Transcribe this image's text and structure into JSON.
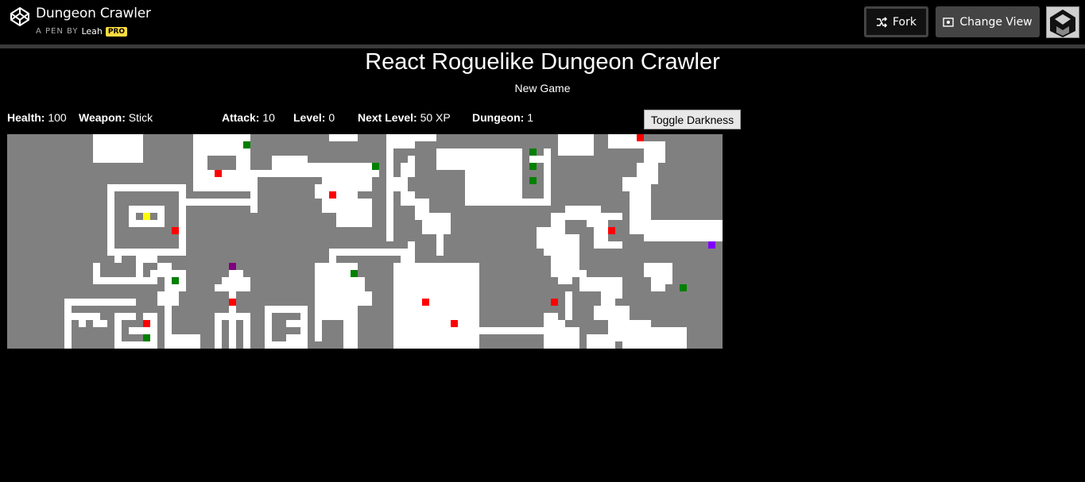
{
  "header": {
    "title": "Dungeon Crawler",
    "byline": "A PEN BY",
    "author": "Leah",
    "pro_badge": "PRO",
    "fork_label": "Fork",
    "change_view_label": "Change View"
  },
  "game": {
    "title": "React Roguelike Dungeon Crawler",
    "new_game": "New Game",
    "toggle_darkness": "Toggle Darkness",
    "stats": {
      "health_label": "Health:",
      "health": "100",
      "weapon_label": "Weapon:",
      "weapon": "Stick",
      "attack_label": "Attack:",
      "attack": "10",
      "level_label": "Level:",
      "level": "0",
      "next_level_label": "Next Level:",
      "next_level": "50 XP",
      "dungeon_label": "Dungeon:",
      "dungeon": "1"
    }
  },
  "map": {
    "columns": 100,
    "rows": 30,
    "colors": {
      "wall": "#808080",
      "floor": "#ffffff",
      "player": "#ffff00",
      "enemy": "#ff0000",
      "health": "#008000",
      "weapon": "#800080",
      "exit": "#8000ff"
    },
    "floor_rects": [
      [
        12,
        0,
        7,
        4
      ],
      [
        26,
        0,
        8,
        3
      ],
      [
        26,
        3,
        2,
        5
      ],
      [
        28,
        5,
        6,
        2
      ],
      [
        32,
        3,
        2,
        4
      ],
      [
        26,
        7,
        8,
        1
      ],
      [
        14,
        7,
        11,
        1
      ],
      [
        14,
        7,
        1,
        10
      ],
      [
        24,
        7,
        1,
        10
      ],
      [
        14,
        16,
        11,
        1
      ],
      [
        17,
        10,
        5,
        1
      ],
      [
        17,
        10,
        1,
        3
      ],
      [
        21,
        10,
        1,
        3
      ],
      [
        17,
        12,
        5,
        1
      ],
      [
        25,
        9,
        10,
        1
      ],
      [
        34,
        5,
        1,
        6
      ],
      [
        34,
        5,
        3,
        1
      ],
      [
        37,
        3,
        5,
        3
      ],
      [
        42,
        4,
        3,
        2
      ],
      [
        44,
        4,
        2,
        3
      ],
      [
        46,
        4,
        6,
        2
      ],
      [
        45,
        6,
        6,
        2
      ],
      [
        43,
        7,
        6,
        2
      ],
      [
        44,
        9,
        7,
        2
      ],
      [
        46,
        11,
        5,
        2
      ],
      [
        45,
        0,
        4,
        1
      ],
      [
        53,
        0,
        1,
        15
      ],
      [
        53,
        0,
        7,
        1
      ],
      [
        54,
        1,
        3,
        1
      ],
      [
        56,
        3,
        1,
        1
      ],
      [
        55,
        4,
        2,
        2
      ],
      [
        54,
        6,
        2,
        2
      ],
      [
        55,
        8,
        2,
        2
      ],
      [
        57,
        9,
        2,
        3
      ],
      [
        58,
        11,
        4,
        3
      ],
      [
        60,
        14,
        1,
        3
      ],
      [
        60,
        2,
        12,
        3
      ],
      [
        64,
        5,
        8,
        5
      ],
      [
        64,
        9,
        12,
        1
      ],
      [
        75,
        2,
        1,
        8
      ],
      [
        73,
        3,
        3,
        1
      ],
      [
        77,
        0,
        5,
        3
      ],
      [
        84,
        0,
        5,
        2
      ],
      [
        89,
        1,
        3,
        3
      ],
      [
        88,
        4,
        3,
        3
      ],
      [
        86,
        6,
        4,
        2
      ],
      [
        87,
        8,
        3,
        6
      ],
      [
        89,
        12,
        11,
        3
      ],
      [
        76,
        11,
        2,
        3
      ],
      [
        78,
        10,
        3,
        2
      ],
      [
        77,
        14,
        3,
        3
      ],
      [
        81,
        10,
        2,
        3
      ],
      [
        81,
        11,
        5,
        1
      ],
      [
        82,
        12,
        2,
        4
      ],
      [
        82,
        15,
        4,
        1
      ],
      [
        78,
        17,
        2,
        3
      ],
      [
        75,
        14,
        1,
        3
      ],
      [
        74,
        13,
        4,
        3
      ],
      [
        76,
        16,
        2,
        4
      ],
      [
        77,
        19,
        2,
        2
      ],
      [
        80,
        19,
        1,
        2
      ],
      [
        80,
        20,
        6,
        2
      ],
      [
        83,
        21,
        3,
        2
      ],
      [
        83,
        23,
        2,
        3
      ],
      [
        82,
        24,
        5,
        2
      ],
      [
        78,
        22,
        1,
        4
      ],
      [
        91,
        19,
        2,
        2
      ],
      [
        89,
        18,
        4,
        2
      ],
      [
        90,
        20,
        2,
        2
      ],
      [
        84,
        26,
        6,
        3
      ],
      [
        86,
        27,
        9,
        3
      ],
      [
        81,
        28,
        4,
        2
      ],
      [
        78,
        27,
        2,
        3
      ],
      [
        75,
        25,
        2,
        2
      ],
      [
        76,
        26,
        2,
        4
      ],
      [
        66,
        27,
        10,
        1
      ],
      [
        75,
        25,
        1,
        5
      ],
      [
        54,
        18,
        12,
        12
      ],
      [
        55,
        17,
        1,
        3
      ],
      [
        46,
        16,
        11,
        1
      ],
      [
        56,
        15,
        1,
        4
      ],
      [
        45,
        16,
        1,
        3
      ],
      [
        44,
        18,
        3,
        1
      ],
      [
        43,
        18,
        1,
        11
      ],
      [
        43,
        18,
        6,
        2
      ],
      [
        43,
        20,
        7,
        2
      ],
      [
        43,
        22,
        8,
        2
      ],
      [
        43,
        24,
        6,
        2
      ],
      [
        47,
        26,
        2,
        4
      ],
      [
        36,
        24,
        6,
        1
      ],
      [
        36,
        24,
        1,
        6
      ],
      [
        41,
        24,
        1,
        6
      ],
      [
        36,
        29,
        6,
        1
      ],
      [
        39,
        26,
        3,
        1
      ],
      [
        39,
        28,
        3,
        1
      ],
      [
        31,
        19,
        2,
        1
      ],
      [
        30,
        20,
        4,
        2
      ],
      [
        29,
        21,
        5,
        1
      ],
      [
        31,
        22,
        1,
        3
      ],
      [
        29,
        25,
        1,
        5
      ],
      [
        29,
        25,
        5,
        1
      ],
      [
        31,
        25,
        1,
        5
      ],
      [
        33,
        25,
        1,
        5
      ],
      [
        21,
        18,
        2,
        1
      ],
      [
        22,
        19,
        3,
        3
      ],
      [
        21,
        22,
        3,
        2
      ],
      [
        22,
        24,
        1,
        6
      ],
      [
        22,
        28,
        5,
        2
      ],
      [
        12,
        18,
        1,
        3
      ],
      [
        12,
        20,
        9,
        1
      ],
      [
        18,
        18,
        1,
        3
      ],
      [
        15,
        17,
        1,
        1
      ],
      [
        18,
        17,
        3,
        1
      ],
      [
        20,
        19,
        3,
        1
      ],
      [
        8,
        23,
        10,
        1
      ],
      [
        8,
        23,
        1,
        7
      ],
      [
        8,
        25,
        5,
        1
      ],
      [
        10,
        25,
        1,
        2
      ],
      [
        12,
        26,
        2,
        1
      ],
      [
        15,
        25,
        1,
        5
      ],
      [
        15,
        25,
        3,
        1
      ],
      [
        17,
        27,
        2,
        1
      ],
      [
        16,
        29,
        3,
        1
      ],
      [
        19,
        26,
        2,
        4
      ],
      [
        19,
        25,
        2,
        1
      ]
    ],
    "entities": [
      {
        "type": "player",
        "col": 19,
        "row": 11
      },
      {
        "type": "enemy",
        "col": 29,
        "row": 5
      },
      {
        "type": "enemy",
        "col": 45,
        "row": 8
      },
      {
        "type": "enemy",
        "col": 23,
        "row": 13
      },
      {
        "type": "enemy",
        "col": 31,
        "row": 23
      },
      {
        "type": "enemy",
        "col": 19,
        "row": 26
      },
      {
        "type": "enemy",
        "col": 58,
        "row": 23
      },
      {
        "type": "enemy",
        "col": 62,
        "row": 26
      },
      {
        "type": "enemy",
        "col": 76,
        "row": 23
      },
      {
        "type": "enemy",
        "col": 84,
        "row": 13
      },
      {
        "type": "enemy",
        "col": 88,
        "row": 0
      },
      {
        "type": "health",
        "col": 33,
        "row": 1
      },
      {
        "type": "health",
        "col": 51,
        "row": 4
      },
      {
        "type": "health",
        "col": 73,
        "row": 2
      },
      {
        "type": "health",
        "col": 73,
        "row": 4
      },
      {
        "type": "health",
        "col": 73,
        "row": 6
      },
      {
        "type": "health",
        "col": 23,
        "row": 20
      },
      {
        "type": "health",
        "col": 48,
        "row": 19
      },
      {
        "type": "health",
        "col": 94,
        "row": 21
      },
      {
        "type": "health",
        "col": 19,
        "row": 28
      },
      {
        "type": "weapon",
        "col": 31,
        "row": 18
      },
      {
        "type": "exit",
        "col": 98,
        "row": 15
      }
    ]
  }
}
